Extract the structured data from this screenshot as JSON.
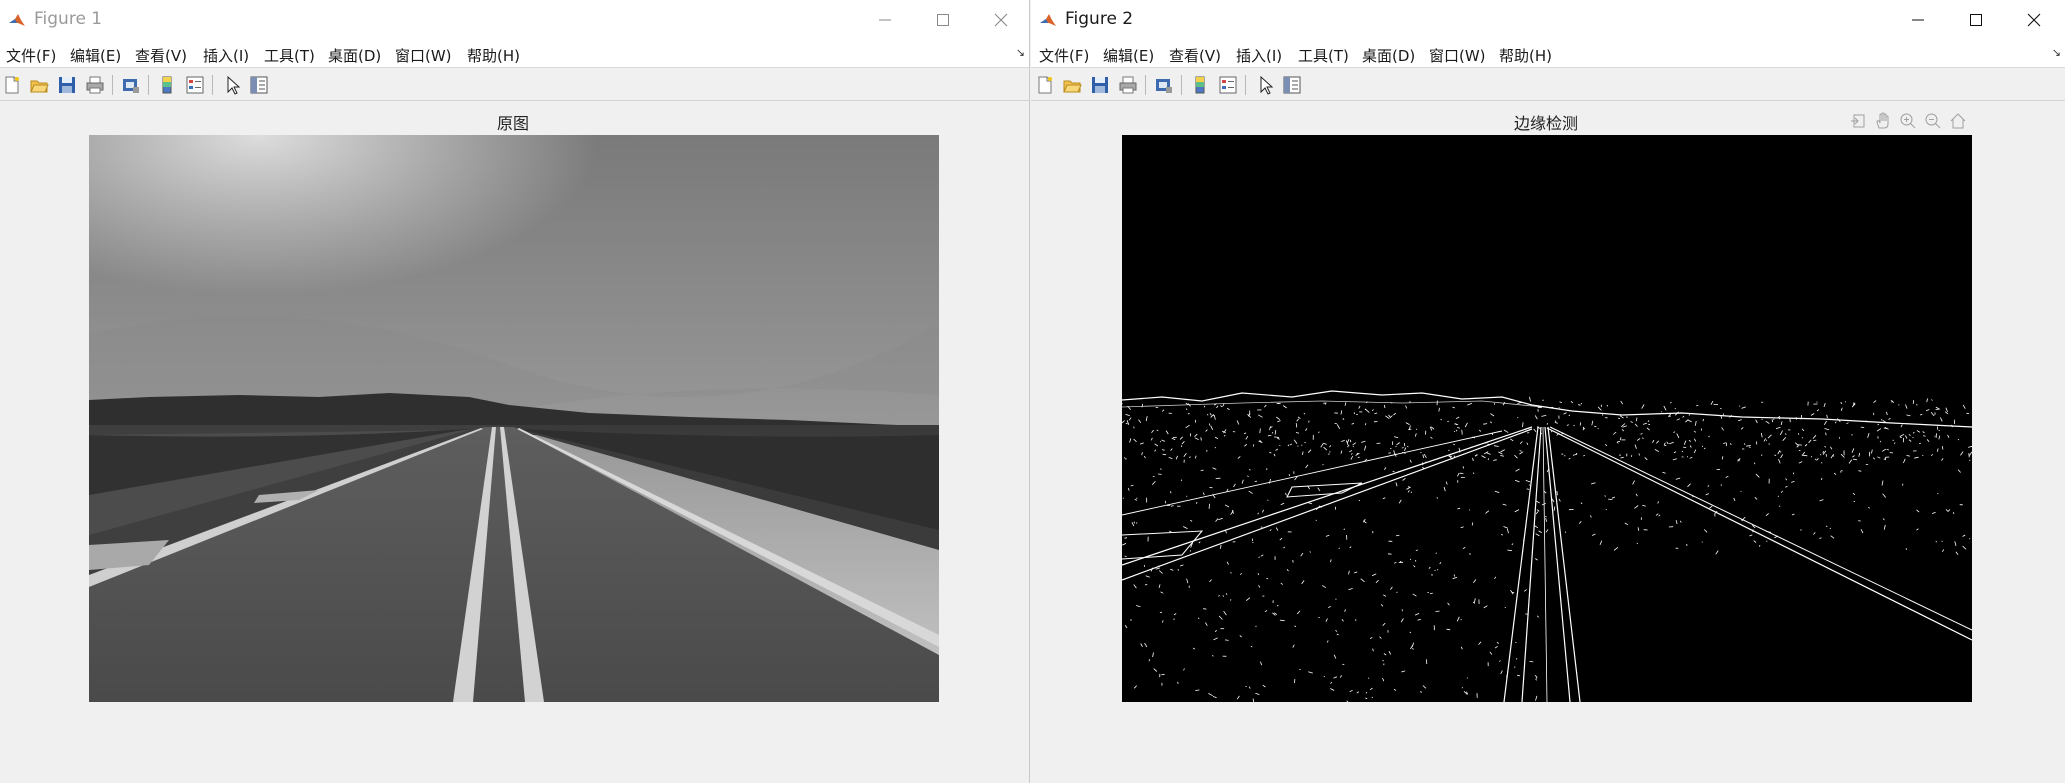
{
  "windows": [
    {
      "title": "Figure 1",
      "menus": [
        "文件(F)",
        "编辑(E)",
        "查看(V)",
        "插入(I)",
        "工具(T)",
        "桌面(D)",
        "窗口(W)",
        "帮助(H)"
      ],
      "axes_title": "原图"
    },
    {
      "title": "Figure 2",
      "menus": [
        "文件(F)",
        "编辑(E)",
        "查看(V)",
        "插入(I)",
        "工具(T)",
        "桌面(D)",
        "窗口(W)",
        "帮助(H)"
      ],
      "axes_title": "边缘检测"
    }
  ],
  "toolbar_icons": [
    "new-file-icon",
    "open-folder-icon",
    "save-icon",
    "print-icon",
    "print-preview-icon",
    "colorbar-icon",
    "legend-icon",
    "pointer-icon",
    "property-inspector-icon"
  ],
  "axes_toolbar_icons": [
    "export-icon",
    "pan-icon",
    "zoom-in-icon",
    "zoom-out-icon",
    "home-icon"
  ],
  "colors": {
    "titlebar": "#ffffff",
    "window_bg": "#f0f0f0",
    "accent": "#d9642a"
  }
}
